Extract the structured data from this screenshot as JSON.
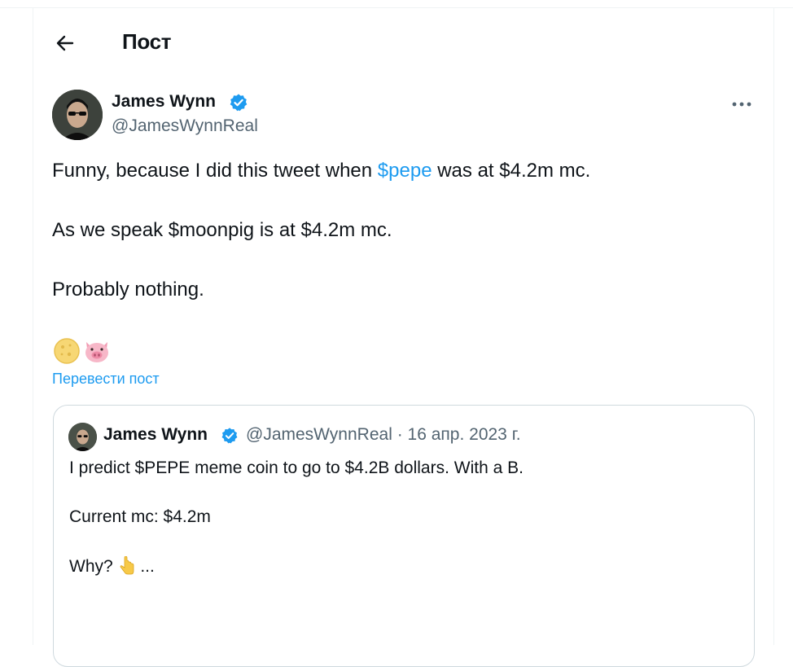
{
  "header": {
    "title": "Пост"
  },
  "author": {
    "name": "James Wynn",
    "handle": "@JamesWynnReal"
  },
  "tweet": {
    "line1_before": "Funny, because I did this tweet when ",
    "line1_cashtag": "$pepe",
    "line1_after": " was at $4.2m mc.",
    "line2": "As we speak $moonpig is at $4.2m mc.",
    "line3": "Probably nothing.",
    "emojis": [
      "coin-icon",
      "pig-face-icon"
    ],
    "translate_label": "Перевести пост"
  },
  "quoted": {
    "name": "James Wynn",
    "handle": "@JamesWynnReal",
    "separator": "·",
    "date": "16 апр. 2023 г.",
    "line1": "I predict $PEPE meme coin to go to $4.2B dollars. With a B.",
    "line2": "Current mc: $4.2m",
    "line3_before": "Why? ",
    "line3_emoji": "point-down-icon",
    "line3_after": " ..."
  },
  "colors": {
    "accent": "#1d9bf0",
    "secondary_text": "#536471",
    "border": "#cfd9de",
    "verified": "#1d9bf0"
  }
}
